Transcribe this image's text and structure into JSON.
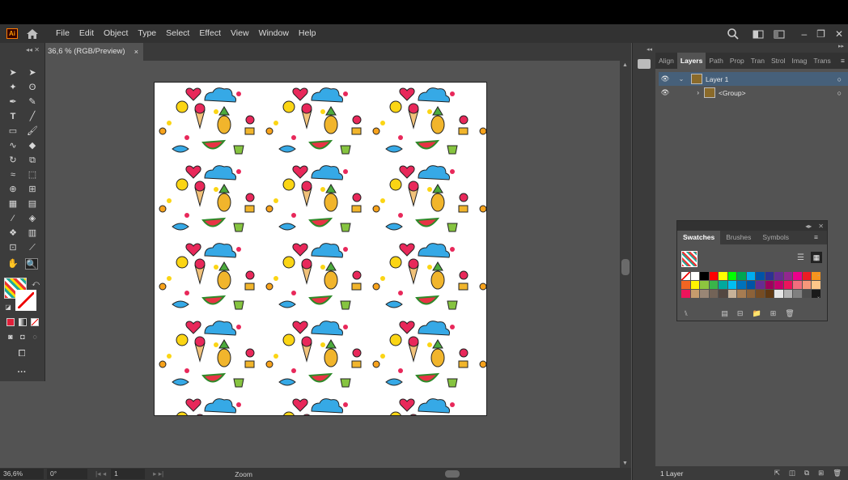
{
  "app": {
    "logo_text": "Ai"
  },
  "menu": [
    "File",
    "Edit",
    "Object",
    "Type",
    "Select",
    "Effect",
    "View",
    "Window",
    "Help"
  ],
  "doc_tab": {
    "title": "36,6 % (RGB/Preview)",
    "close": "×"
  },
  "status": {
    "zoom": "36,6%",
    "rotation": "0°",
    "artboard": "1",
    "mode": "Zoom"
  },
  "layers_panel": {
    "tabs": [
      "Align",
      "Layers",
      "Path",
      "Prop",
      "Tran",
      "Strol",
      "Imag",
      "Trans"
    ],
    "active_tab": "Layers",
    "rows": [
      {
        "name": "Layer 1"
      },
      {
        "name": "<Group>"
      }
    ],
    "footer": "1 Layer"
  },
  "swatches_panel": {
    "tabs": [
      "Swatches",
      "Brushes",
      "Symbols"
    ],
    "colors": [
      "#ffffff",
      "#ffffff",
      "#000000",
      "#ff0000",
      "#ffff00",
      "#00ff00",
      "#00a651",
      "#00aeef",
      "#0054a6",
      "#2e3192",
      "#662d91",
      "#92278f",
      "#ec008c",
      "#ed1c24",
      "#f7941d",
      "#f26522",
      "#fff200",
      "#8dc63f",
      "#39b54a",
      "#00a99d",
      "#00bff3",
      "#0072bc",
      "#0054a6",
      "#662d91",
      "#9e005d",
      "#c4006c",
      "#ed145b",
      "#f26d7d",
      "#f7977a",
      "#fdc689",
      "#ed145b",
      "#c69c6d",
      "#998675",
      "#736357",
      "#534741",
      "#c7b299",
      "#a67c52",
      "#8c6239",
      "#754c24",
      "#603913",
      "#e6e6e6",
      "#b3b3b3",
      "#808080",
      "#4d4d4d",
      "#1a1a1a"
    ]
  }
}
